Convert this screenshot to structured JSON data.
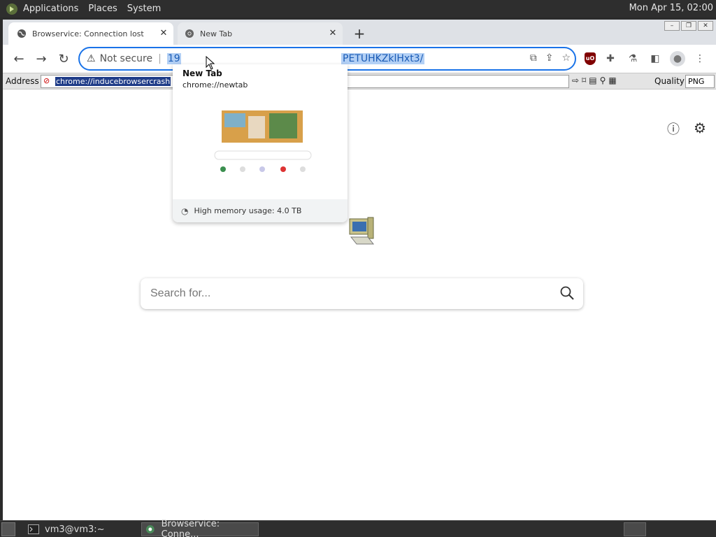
{
  "desktop": {
    "menus": [
      "Applications",
      "Places",
      "System"
    ],
    "clock": "Mon Apr 15, 02:00"
  },
  "browser": {
    "tabs": [
      {
        "title": "Browservice: Connection lost",
        "active": true
      },
      {
        "title": "New Tab",
        "active": false
      }
    ],
    "omnibox": {
      "security_label": "Not secure",
      "url_start": "19",
      "url_end": "PETUHKZklHxt3/"
    },
    "hover_card": {
      "title": "New Tab",
      "url": "chrome://newtab",
      "memory": "High memory usage: 4.0 TB"
    },
    "address_bar": {
      "label": "Address",
      "value": "chrome://inducebrowsercrash",
      "quality_label": "Quality",
      "quality_value": "PNG"
    },
    "page": {
      "search_placeholder": "Search for..."
    }
  },
  "taskbar": {
    "tasks": [
      {
        "label": "vm3@vm3:~"
      },
      {
        "label": "Browservice: Conne..."
      }
    ]
  },
  "colors": {
    "accent": "#1a73e8",
    "selection": "#b3d0f5",
    "address_selection": "#1f3c88",
    "panel": "#2e2e2e"
  }
}
